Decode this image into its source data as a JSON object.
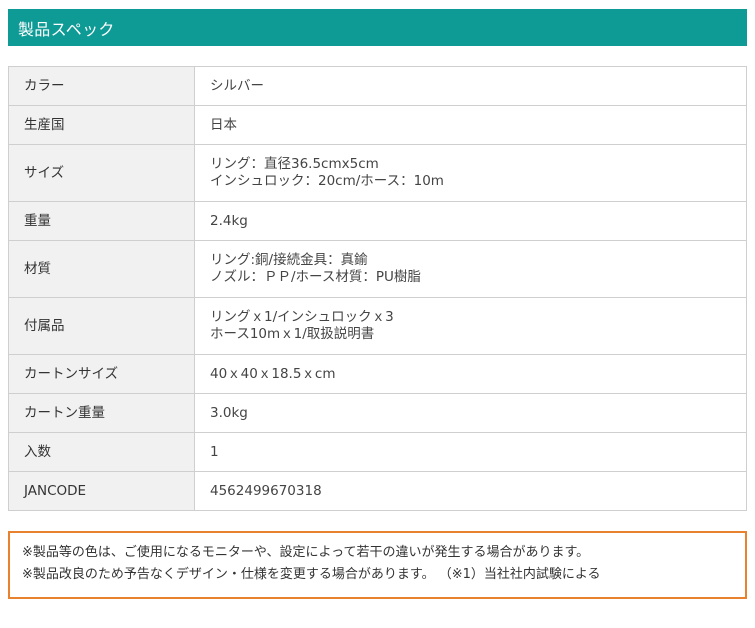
{
  "header": {
    "title": "製品スペック"
  },
  "specs": [
    {
      "label": "カラー",
      "lines": [
        "シルバー"
      ]
    },
    {
      "label": "生産国",
      "lines": [
        "日本"
      ]
    },
    {
      "label": "サイズ",
      "lines": [
        "リング：直径36.5cmx5cm",
        "インシュロック：20cm/ホース：10m"
      ]
    },
    {
      "label": "重量",
      "lines": [
        "2.4kg"
      ]
    },
    {
      "label": "材質",
      "lines": [
        "リング:銅/接続金具：真鍮",
        "ノズル：ＰＰ/ホース材質：PU樹脂"
      ]
    },
    {
      "label": "付属品",
      "lines": [
        "リングｘ1/インシュロックｘ3",
        "ホース10mｘ1/取扱説明書"
      ]
    },
    {
      "label": "カートンサイズ",
      "lines": [
        "40ｘ40ｘ18.5ｘcm"
      ]
    },
    {
      "label": "カートン重量",
      "lines": [
        "3.0kg"
      ]
    },
    {
      "label": "入数",
      "lines": [
        "1"
      ]
    },
    {
      "label": "JANCODE",
      "lines": [
        "4562499670318"
      ]
    }
  ],
  "notice": {
    "lines": [
      "※製品等の色は、ご使用になるモニターや、設定によって若干の違いが発生する場合があります。",
      "※製品改良のため予告なくデザイン・仕様を変更する場合があります。 （※1）当社社内試験による"
    ]
  },
  "colors": {
    "header_bg": "#0e9a95",
    "header_text": "#ffffff",
    "label_bg": "#f1f1f1",
    "border": "#cfcfcf",
    "notice_border": "#e8822e"
  }
}
